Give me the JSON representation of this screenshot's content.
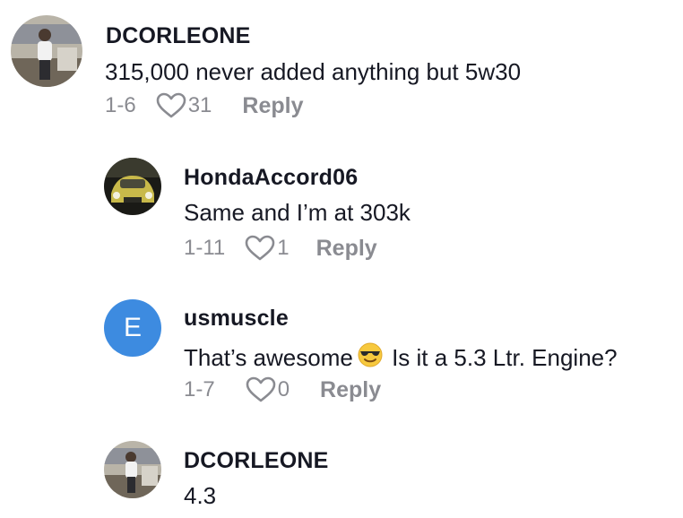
{
  "comments": [
    {
      "username": "DCORLEONE",
      "text": "315,000 never added anything but 5w30",
      "date": "1-6",
      "likes": "31",
      "reply_label": "Reply",
      "avatar_icon": "user-photo"
    },
    {
      "username": "HondaAccord06",
      "text": "Same and I’m at 303k",
      "date": "1-11",
      "likes": "1",
      "reply_label": "Reply",
      "avatar_icon": "car-photo"
    },
    {
      "username": "usmuscle",
      "text_before": "That’s awesome",
      "text_after": "Is it a 5.3 Ltr. Engine?",
      "emoji_icon": "sunglasses-emoji",
      "date": "1-7",
      "likes": "0",
      "reply_label": "Reply",
      "avatar_letter": "E",
      "avatar_color": "#3d8be0"
    },
    {
      "username": "DCORLEONE",
      "text": "4.3",
      "avatar_icon": "user-photo"
    }
  ]
}
